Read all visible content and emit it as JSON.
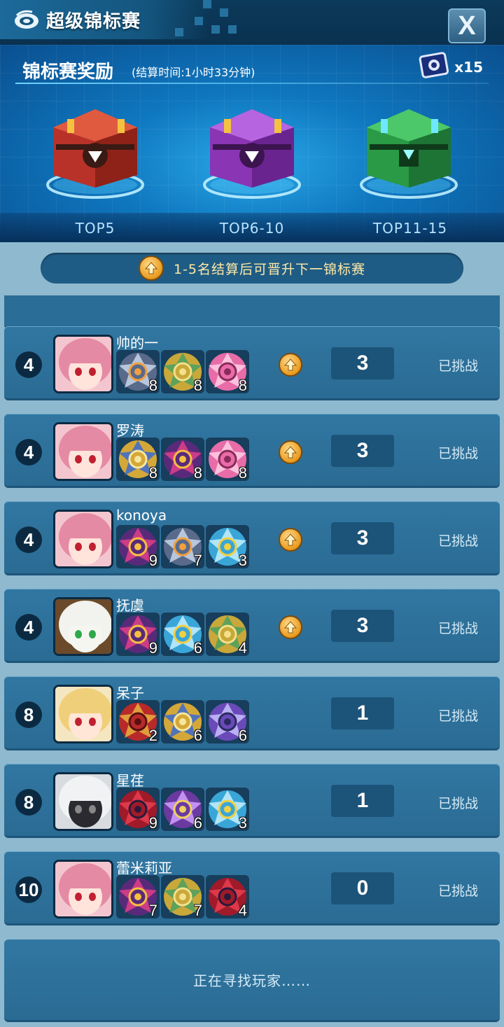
{
  "header": {
    "title": "超级锦标赛",
    "close_label": "X"
  },
  "rewards": {
    "title": "锦标赛奖励",
    "settle_time": "(结算时间:1小时33分钟)",
    "ticket_count": "x15",
    "tiers": [
      {
        "label": "TOP5",
        "chest_color": "#c83a2a"
      },
      {
        "label": "TOP6-10",
        "chest_color": "#9b3fc2"
      },
      {
        "label": "TOP11-15",
        "chest_color": "#2fae4e"
      }
    ]
  },
  "promo": {
    "text": "1-5名结算后可晋升下一锦标赛"
  },
  "players": [
    {
      "rank": "4",
      "name": "帅的一",
      "avatar": "pink-hair-girl",
      "tops": [
        {
          "style": "tiger",
          "level": "8"
        },
        {
          "style": "gold-green",
          "level": "8"
        },
        {
          "style": "pink-flower",
          "level": "8"
        }
      ],
      "promote": true,
      "score": "3",
      "status": "已挑战"
    },
    {
      "rank": "4",
      "name": "罗涛",
      "avatar": "pink-hair-girl",
      "tops": [
        {
          "style": "gold-blue",
          "level": "8"
        },
        {
          "style": "purple-pink",
          "level": "8"
        },
        {
          "style": "pink-flower",
          "level": "8"
        }
      ],
      "promote": true,
      "score": "3",
      "status": "已挑战"
    },
    {
      "rank": "4",
      "name": "konoya",
      "avatar": "pink-hair-girl",
      "tops": [
        {
          "style": "purple-pink",
          "level": "9"
        },
        {
          "style": "tiger",
          "level": "7"
        },
        {
          "style": "cyan-sun",
          "level": "3"
        }
      ],
      "promote": true,
      "score": "3",
      "status": "已挑战"
    },
    {
      "rank": "4",
      "name": "抚虞",
      "avatar": "goggles-dog",
      "tops": [
        {
          "style": "purple-pink",
          "level": "9"
        },
        {
          "style": "cyan-sun",
          "level": "6"
        },
        {
          "style": "gold-green",
          "level": "4"
        }
      ],
      "promote": true,
      "score": "3",
      "status": "已挑战"
    },
    {
      "rank": "8",
      "name": "呆子",
      "avatar": "blonde-glasses",
      "tops": [
        {
          "style": "red-gold",
          "level": "2"
        },
        {
          "style": "gold-blue",
          "level": "6"
        },
        {
          "style": "violet-knight",
          "level": "6"
        }
      ],
      "promote": false,
      "score": "1",
      "status": "已挑战"
    },
    {
      "rank": "8",
      "name": "星荏",
      "avatar": "white-hair-mask",
      "tops": [
        {
          "style": "red-dark",
          "level": "9"
        },
        {
          "style": "violet-star",
          "level": "6"
        },
        {
          "style": "cyan-sun",
          "level": "3"
        }
      ],
      "promote": false,
      "score": "1",
      "status": "已挑战"
    },
    {
      "rank": "10",
      "name": "蕾米莉亚",
      "avatar": "pink-hair-girl",
      "tops": [
        {
          "style": "purple-pink",
          "level": "7"
        },
        {
          "style": "gold-green",
          "level": "7"
        },
        {
          "style": "red-dark",
          "level": "4"
        }
      ],
      "promote": false,
      "score": "0",
      "status": "已挑战"
    }
  ],
  "searching_text": "正在寻找玩家……"
}
